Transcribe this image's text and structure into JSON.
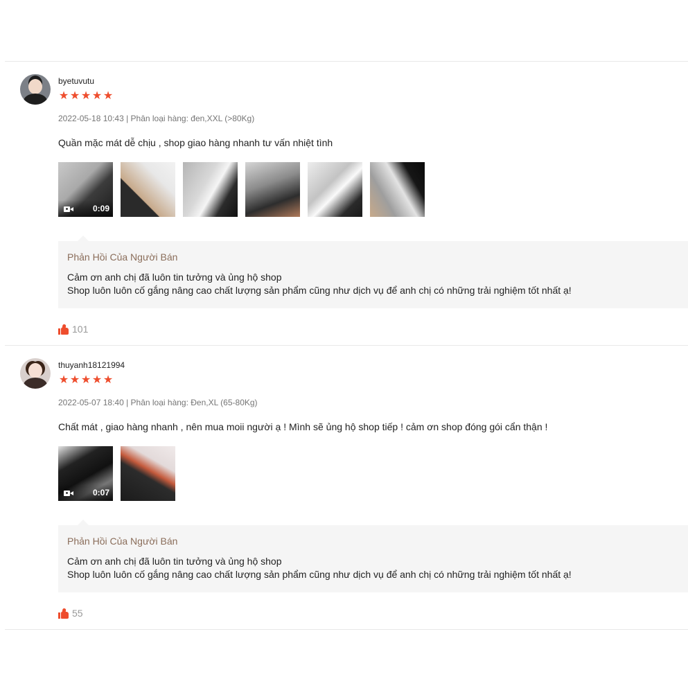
{
  "reviews": [
    {
      "username": "byetuvutu",
      "rating": 5,
      "meta": "2022-05-18 10:43 | Phân loại hàng: đen,XXL (>80Kg)",
      "comment": "Quần mặc mát dễ chịu , shop giao hàng nhanh tư vấn nhiệt tình",
      "video_duration": "0:09",
      "image_count": 6,
      "reply": {
        "title": "Phản Hồi Của Người Bán",
        "line1": "Cảm ơn anh chị đã luôn tin tưởng và ủng hộ shop",
        "line2": "Shop luôn luôn cố gắng nâng cao chất lượng sản phẩm cũng như dịch vụ để anh chị có những trải nghiệm tốt nhất ạ!"
      },
      "likes": "101"
    },
    {
      "username": "thuyanh18121994",
      "rating": 5,
      "meta": "2022-05-07 18:40 | Phân loại hàng: Đen,XL (65-80Kg)",
      "comment": "Chất mát , giao hàng nhanh , nên mua moii người ạ ! Mình sẽ ủng hộ shop tiếp ! cảm ơn shop đóng gói cẩn thận !",
      "video_duration": "0:07",
      "image_count": 2,
      "reply": {
        "title": "Phản Hồi Của Người Bán",
        "line1": "Cảm ơn anh chị đã luôn tin tưởng và ủng hộ shop",
        "line2": "Shop luôn luôn cố gắng nâng cao chất lượng sản phẩm cũng như dịch vụ để anh chị có những trải nghiệm tốt nhất ạ!"
      },
      "likes": "55"
    }
  ],
  "colors": {
    "star": "#ee4d2d",
    "reply_bg": "#f5f5f5",
    "reply_title": "#8a6d5a",
    "meta": "#757575"
  },
  "icons": {
    "star": "star-icon",
    "like": "thumbs-up-icon",
    "video": "video-camera-icon"
  }
}
